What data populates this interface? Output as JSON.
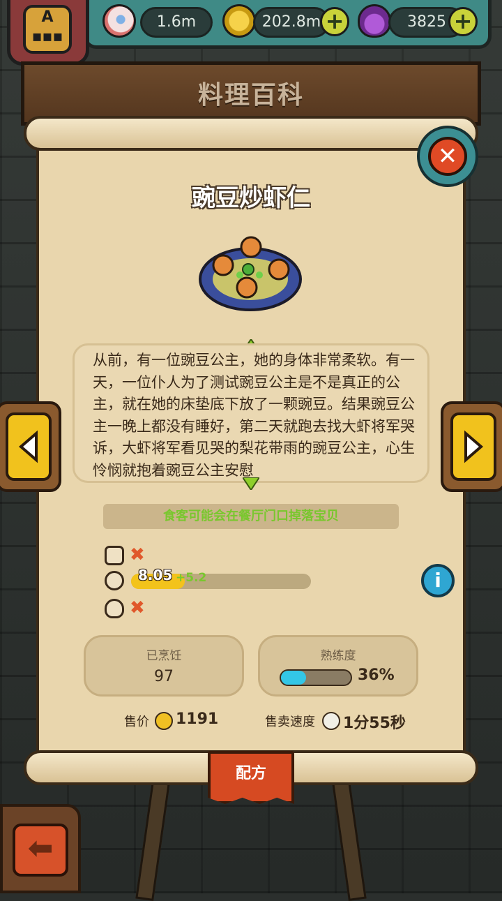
{
  "resources": {
    "eyeballs": "1.6m",
    "coins": "202.8m",
    "potions": "3825",
    "plus_label": "+"
  },
  "player": {
    "rank": "A"
  },
  "header": {
    "title": "料理百科"
  },
  "dish": {
    "name": "豌豆炒虾仁",
    "story": "从前，有一位豌豆公主，她的身体非常柔软。有一天，一位仆人为了测试豌豆公主是不是真正的公主，就在她的床垫底下放了一颗豌豆。结果豌豆公主一晚上都没有睡好，第二天就跑去找大虾将军哭诉，大虾将军看见哭的梨花带雨的豌豆公主，心生怜悯就抱着豌豆公主安慰",
    "tip": "食客可能会在餐厅门口掉落宝贝"
  },
  "stats": {
    "none_mark": "✖",
    "appeal_value": "8.05",
    "appeal_bonus": "+5.2",
    "appeal_fill_fraction": 0.3,
    "cooked_label": "已烹饪",
    "cooked_value": "97",
    "mastery_label": "熟练度",
    "mastery_percent": "36%",
    "mastery_fraction": 0.36,
    "price_label": "售价",
    "price_value": "1191",
    "speed_label": "售卖速度",
    "speed_value": "1分55秒"
  },
  "tabs": {
    "recipe": "配方"
  },
  "colors": {
    "accent_green": "#79c72e",
    "close_red": "#e04a25",
    "mastery_blue": "#33c6e6",
    "appeal_yellow": "#f3c31b"
  }
}
